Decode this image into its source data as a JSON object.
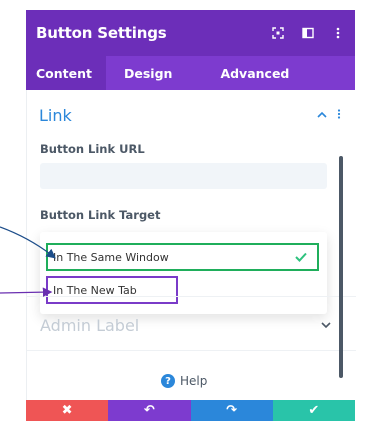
{
  "header": {
    "title": "Button Settings",
    "actions": [
      "expand-icon",
      "sidebar-icon",
      "more-icon"
    ]
  },
  "tabs": [
    {
      "label": "Content",
      "active": true
    },
    {
      "label": "Design",
      "active": false
    },
    {
      "label": "Advanced",
      "active": false
    }
  ],
  "section": {
    "title": "Link"
  },
  "fields": {
    "url_label": "Button Link URL",
    "url_value": "",
    "target_label": "Button Link Target"
  },
  "dropdown": {
    "options": [
      {
        "label": "In The Same Window",
        "selected": true
      },
      {
        "label": "In The New Tab",
        "selected": false
      }
    ]
  },
  "admin": {
    "label": "Admin Label"
  },
  "help": {
    "label": "Help"
  },
  "footer": {
    "cancel_icon": "✖",
    "undo_icon": "↶",
    "redo_icon": "↷",
    "save_icon": "✔"
  },
  "colors": {
    "header": "#6c2eb9",
    "tabs": "#7d3bcf",
    "accent_blue": "#2b87da",
    "highlight_green": "#1fae5b",
    "highlight_purple": "#7a3bc8",
    "cancel": "#ef5555",
    "save": "#29c4a9"
  }
}
